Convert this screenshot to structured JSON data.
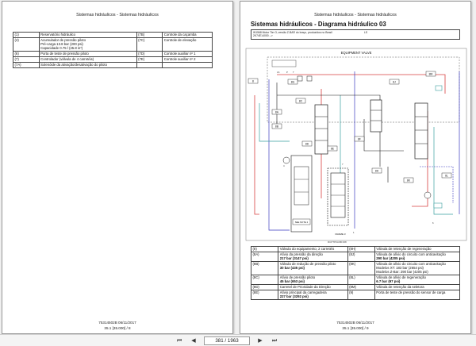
{
  "left_page": {
    "header": "Sistemas hidráulicos - Sistemas hidráulicos",
    "rows": [
      {
        "c1": "(1)",
        "d1": [
          "Reservatório hidráulico"
        ],
        "c2": "(7B)",
        "d2": "Controle da caçamba"
      },
      {
        "c1": "(4)",
        "d1": [
          "Acumulador de pressão piloto",
          "Pré-carga 13.8 bar (200 psi)",
          "Capacidade 0.75 l (45.8 in³)"
        ],
        "c2": "(7C)",
        "d2": "Controle de elevação"
      },
      {
        "c1": "(6)",
        "d1": [
          "Porta de teste de pressão piloto"
        ],
        "c2": "(7D)",
        "d2": "Controle auxiliar nº 1"
      },
      {
        "c1": "(7)",
        "d1": [
          "Controlador (válvula de 4 carretéis)"
        ],
        "c2": "(7E)",
        "d2": "Controle auxiliar nº 2"
      },
      {
        "c1": "(7A)",
        "d1": [
          "Solenóide da ativação/desativação do piloto"
        ],
        "c2": "",
        "d2": ""
      }
    ],
    "footer_code": "75314502B 06/11/2017",
    "footer_page": "35.1 [35.000] / 8"
  },
  "right_page": {
    "header": "Sistemas hidráulicos - Sistemas hidráulicos",
    "title": "Sistemas hidráulicos - Diagrama hidráulico 03",
    "info_line1": "W1568 Motor Tier 3, versão Z-BAR do braço, produzidos no Brasil",
    "info_line2": "2K74E14000 -->",
    "info_tag": "LS",
    "diagram": {
      "heading": "EQUIPMENT VALVE",
      "labels": [
        "8",
        "8G",
        "8J",
        "8M",
        "8A",
        "8B",
        "8C",
        "8D",
        "8E",
        "8F",
        "8H",
        "8K",
        "8L",
        "LS",
        "P",
        "T",
        "7",
        "6",
        "1",
        "4"
      ],
      "frame_label": "FRAME 3",
      "note_label": "SEE NOTE 2",
      "caption": "RCPTP0ASB 008"
    },
    "rows": [
      {
        "c1": "(8)",
        "d1": [
          "Válvula do equipamento, 2 carretéis"
        ],
        "c2": "(8H)",
        "d2": [
          "Válvula de retenção de regeneração"
        ]
      },
      {
        "c1": "(8A)",
        "d1": [
          "Alívio da pressão da direção",
          "217 bar (3147 psi)"
        ],
        "c2": "(8J)",
        "d2": [
          "Válvula de alívio do circuito com anticavitação",
          "290 bar (4205 psi)"
        ]
      },
      {
        "c1": "(8B)",
        "d1": [
          "Válvula de redução de pressão piloto",
          "30 bar (435 psi)"
        ],
        "c2": "(8K)",
        "d2": [
          "Válvula de alívio do circuito com anticavitação",
          "Modelos XT: 183 bar (2654 psi)",
          "Modelos Z-Bar: 290 bar (4205 psi)"
        ]
      },
      {
        "c1": "(8C)",
        "d1": [
          "Alívio de pressão piloto",
          "45 bar (653 psi)"
        ],
        "c2": "(8L)",
        "d2": [
          "Válvula de alívio de regeneração",
          "6.7 bar (97 psi)"
        ]
      },
      {
        "c1": "(8D)",
        "d1": [
          "Carretel de Prioridade da Direção"
        ],
        "c2": "(8M)",
        "d2": [
          "Válvula de retenção da seletora"
        ]
      },
      {
        "c1": "(8E)",
        "d1": [
          "Alívio principal da carregadeira",
          "227 bar (3292 psi)"
        ],
        "c2": "(9)",
        "d2": [
          "Porta de teste de pressão do sensor de carga"
        ]
      }
    ],
    "footer_code": "75314502B 06/11/2017",
    "footer_page": "35.1 [35.000] / 9"
  },
  "toolbar": {
    "page_current": "381",
    "page_total": "1963",
    "page_separator": "/",
    "first": "⏮",
    "prev": "◀",
    "next": "▶",
    "last": "⏭"
  },
  "colors": {
    "pressure": "#d84040",
    "pilot": "#3aa0a0",
    "tank": "#3a3ac0",
    "valve": "#1a1a1a"
  }
}
